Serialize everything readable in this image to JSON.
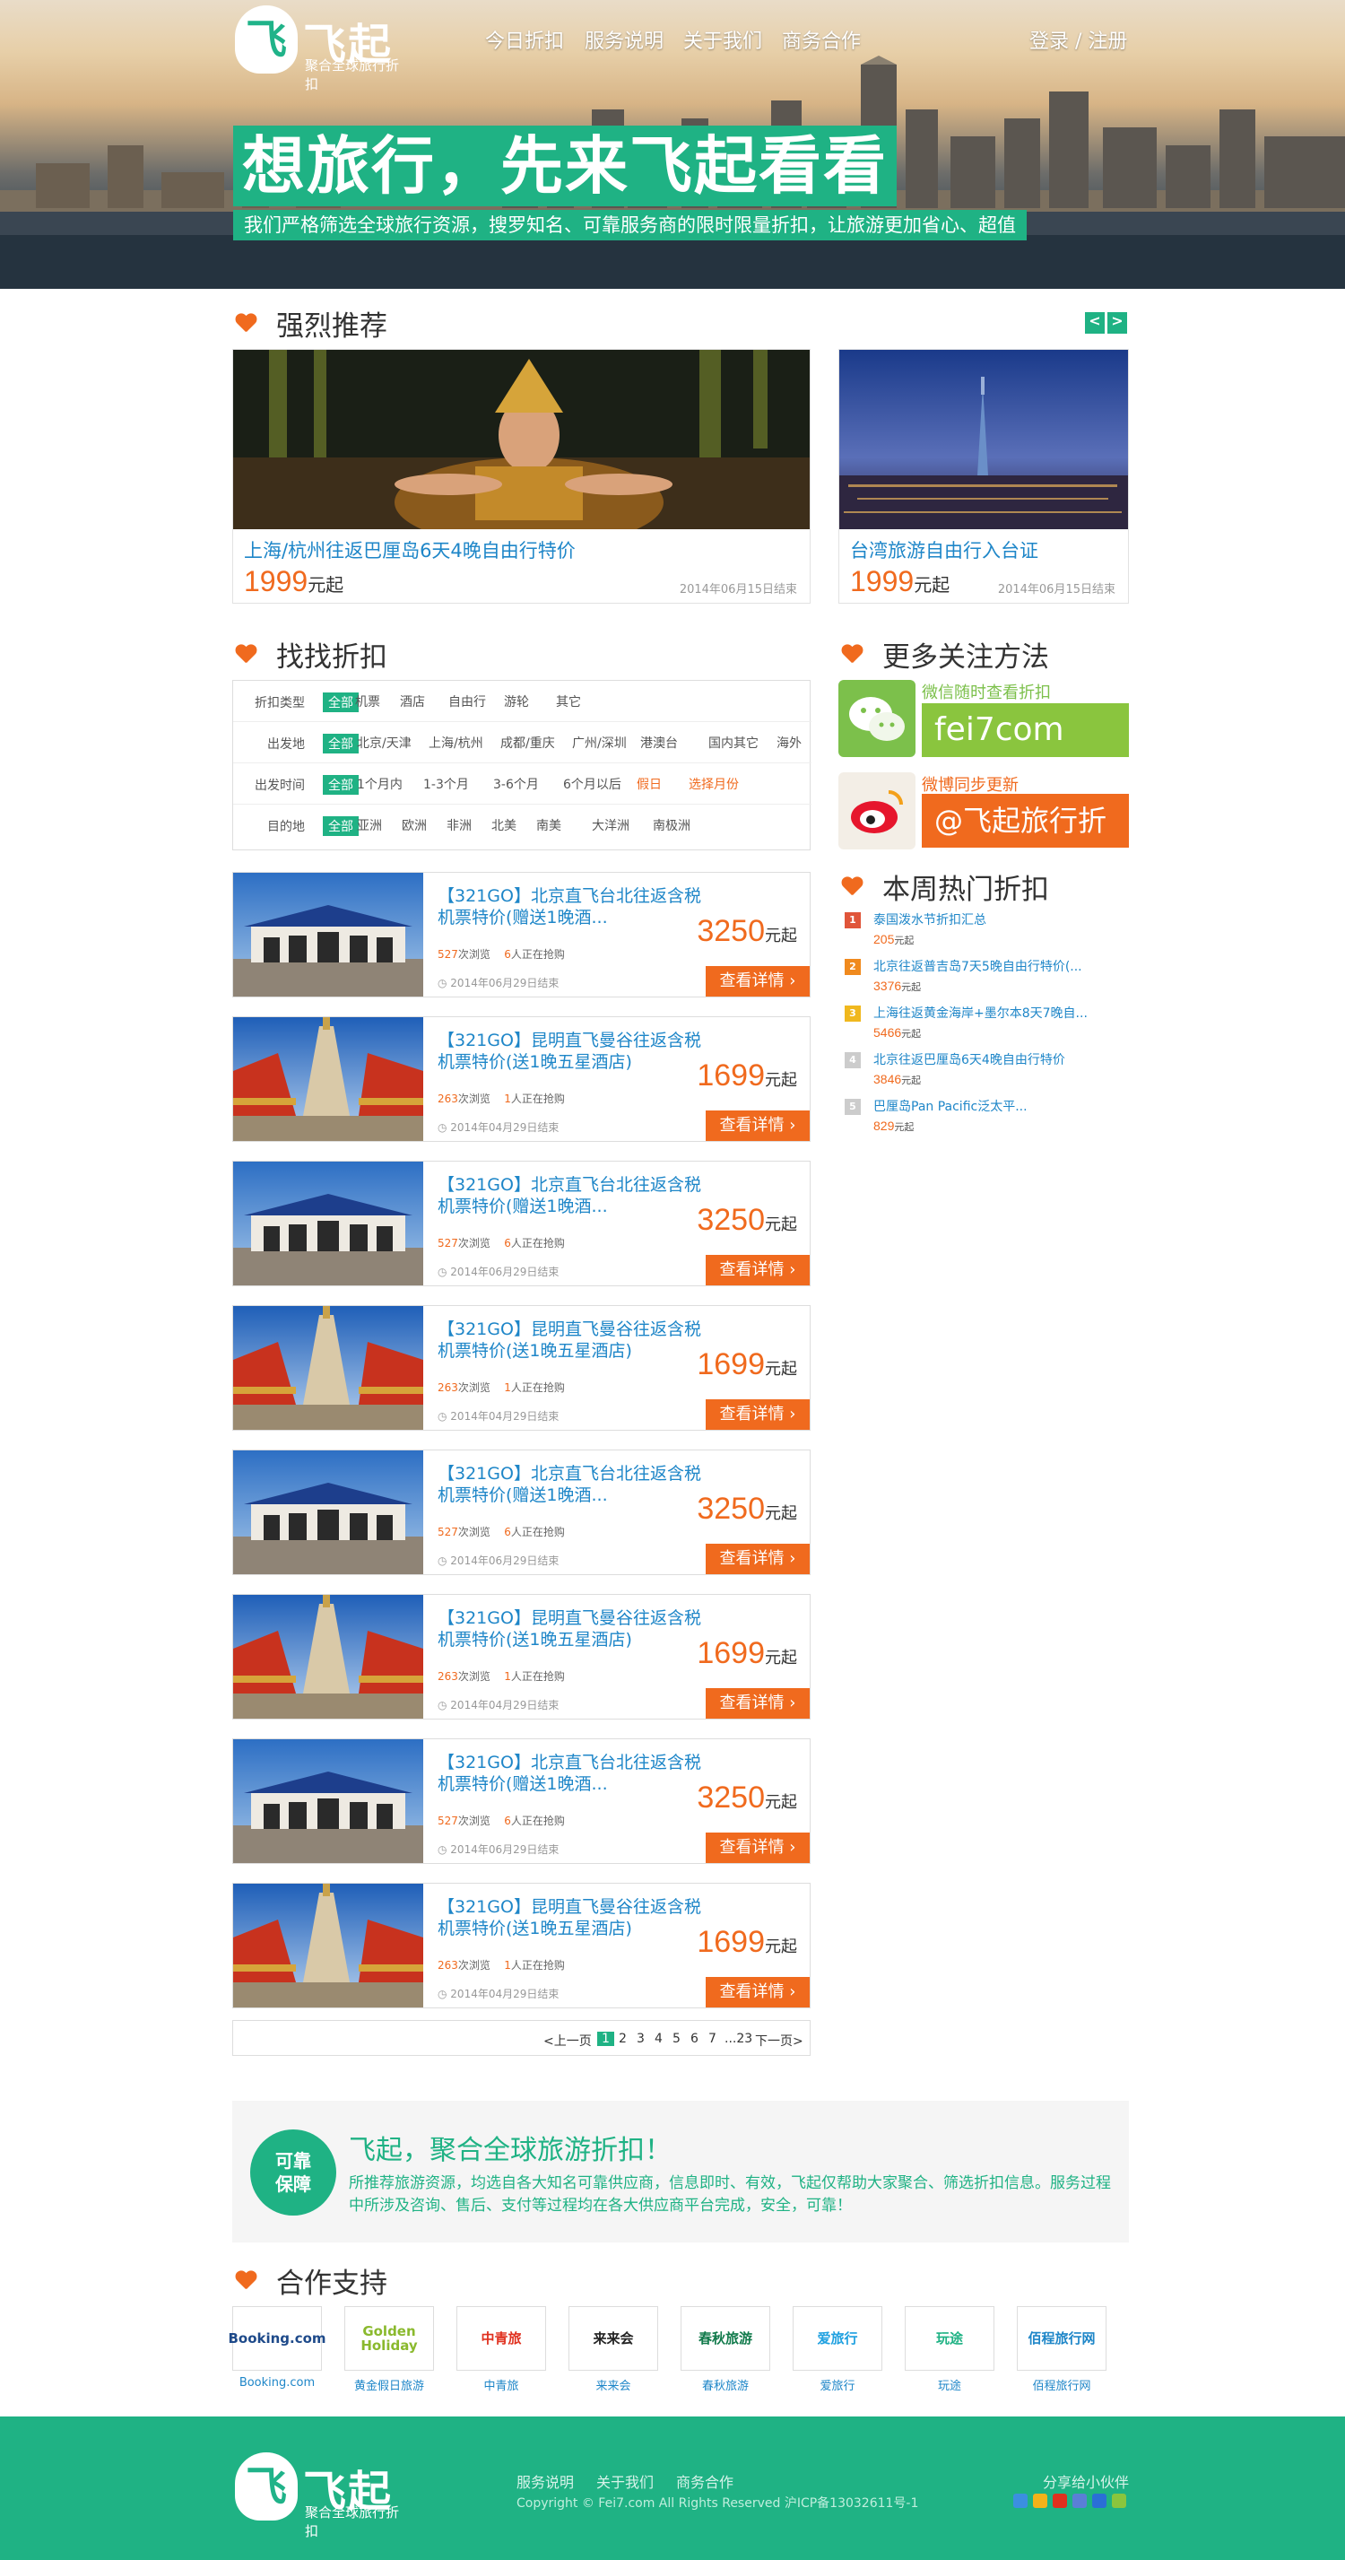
{
  "brand": {
    "name": "飞起",
    "tagline": "聚合全球旅行折扣",
    "glyph": "飞"
  },
  "nav": {
    "items": [
      "今日折扣",
      "服务说明",
      "关于我们",
      "商务合作"
    ],
    "login": "登录 / 注册"
  },
  "banner": {
    "title": "想旅行，先来飞起看看",
    "subtitle": "我们严格筛选全球旅行资源，搜罗知名、可靠服务商的限时限量折扣，让旅游更加省心、超值"
  },
  "recommend": {
    "heading": "强烈推荐",
    "prev": "<",
    "next": ">",
    "cards": [
      {
        "title": "上海/杭州往返巴厘岛6天4晚自由行特价",
        "price": "1999",
        "unit": "元起",
        "date": "2014年06月15日结束"
      },
      {
        "title": "台湾旅游自由行入台证",
        "price": "1999",
        "unit": "元起",
        "date": "2014年06月15日结束"
      }
    ]
  },
  "finder": {
    "heading": "找找折扣",
    "rows": [
      {
        "label": "折扣类型",
        "options": [
          "全部",
          "机票",
          "酒店",
          "自由行",
          "游轮",
          "其它"
        ]
      },
      {
        "label": "出发地",
        "options": [
          "全部",
          "北京/天津",
          "上海/杭州",
          "成都/重庆",
          "广州/深圳",
          "港澳台",
          "国内其它",
          "海外"
        ]
      },
      {
        "label": "出发时间",
        "options": [
          "全部",
          "1个月内",
          "1-3个月",
          "3-6个月",
          "6个月以后",
          "假日",
          "选择月份"
        ]
      },
      {
        "label": "目的地",
        "options": [
          "全部",
          "亚洲",
          "欧洲",
          "非洲",
          "北美",
          "南美",
          "大洋洲",
          "南极洲"
        ]
      }
    ]
  },
  "deals": [
    {
      "title": "【321GO】北京直飞台北往返含税机票特价(赠送1晚酒...",
      "views": "527",
      "views_label": "次浏览",
      "buyers": "6",
      "buyers_label": "人正在抢购",
      "date": "2014年06月29日结束",
      "price": "3250",
      "unit": "元起",
      "button": "查看详情 ›",
      "img": "taipei"
    },
    {
      "title": "【321GO】昆明直飞曼谷往返含税机票特价(送1晚五星酒店)",
      "views": "263",
      "views_label": "次浏览",
      "buyers": "1",
      "buyers_label": "人正在抢购",
      "date": "2014年04月29日结束",
      "price": "1699",
      "unit": "元起",
      "button": "查看详情 ›",
      "img": "bangkok"
    },
    {
      "title": "【321GO】北京直飞台北往返含税机票特价(赠送1晚酒...",
      "views": "527",
      "views_label": "次浏览",
      "buyers": "6",
      "buyers_label": "人正在抢购",
      "date": "2014年06月29日结束",
      "price": "3250",
      "unit": "元起",
      "button": "查看详情 ›",
      "img": "taipei"
    },
    {
      "title": "【321GO】昆明直飞曼谷往返含税机票特价(送1晚五星酒店)",
      "views": "263",
      "views_label": "次浏览",
      "buyers": "1",
      "buyers_label": "人正在抢购",
      "date": "2014年04月29日结束",
      "price": "1699",
      "unit": "元起",
      "button": "查看详情 ›",
      "img": "bangkok"
    },
    {
      "title": "【321GO】北京直飞台北往返含税机票特价(赠送1晚酒...",
      "views": "527",
      "views_label": "次浏览",
      "buyers": "6",
      "buyers_label": "人正在抢购",
      "date": "2014年06月29日结束",
      "price": "3250",
      "unit": "元起",
      "button": "查看详情 ›",
      "img": "taipei"
    },
    {
      "title": "【321GO】昆明直飞曼谷往返含税机票特价(送1晚五星酒店)",
      "views": "263",
      "views_label": "次浏览",
      "buyers": "1",
      "buyers_label": "人正在抢购",
      "date": "2014年04月29日结束",
      "price": "1699",
      "unit": "元起",
      "button": "查看详情 ›",
      "img": "bangkok"
    },
    {
      "title": "【321GO】北京直飞台北往返含税机票特价(赠送1晚酒...",
      "views": "527",
      "views_label": "次浏览",
      "buyers": "6",
      "buyers_label": "人正在抢购",
      "date": "2014年06月29日结束",
      "price": "3250",
      "unit": "元起",
      "button": "查看详情 ›",
      "img": "taipei"
    },
    {
      "title": "【321GO】昆明直飞曼谷往返含税机票特价(送1晚五星酒店)",
      "views": "263",
      "views_label": "次浏览",
      "buyers": "1",
      "buyers_label": "人正在抢购",
      "date": "2014年04月29日结束",
      "price": "1699",
      "unit": "元起",
      "button": "查看详情 ›",
      "img": "bangkok"
    }
  ],
  "pager": {
    "prev": "<上一页",
    "pages": [
      "1",
      "2",
      "3",
      "4",
      "5",
      "6",
      "7",
      "...23"
    ],
    "current": "1",
    "next": "下一页>"
  },
  "follow": {
    "heading": "更多关注方法",
    "wechat_label": "微信随时查看折扣",
    "wechat_id": "fei7com",
    "weibo_label": "微博同步更新",
    "weibo_id": "@飞起旅行折扣"
  },
  "hot": {
    "heading": "本周热门折扣",
    "items": [
      {
        "rank": "1",
        "title": "泰国泼水节折扣汇总",
        "value": "205",
        "unit": "元起"
      },
      {
        "rank": "2",
        "title": "北京往返普吉岛7天5晚自由行特价(...",
        "value": "3376",
        "unit": "元起"
      },
      {
        "rank": "3",
        "title": "上海往返黄金海岸+墨尔本8天7晚自...",
        "value": "5466",
        "unit": "元起"
      },
      {
        "rank": "4",
        "title": "北京往返巴厘岛6天4晚自由行特价",
        "value": "3846",
        "unit": "元起"
      },
      {
        "rank": "5",
        "title": "巴厘岛Pan Pacific泛太平...",
        "value": "829",
        "unit": "元起"
      }
    ]
  },
  "assurance": {
    "badge_line1": "可靠",
    "badge_line2": "保障",
    "heading": "飞起，聚合全球旅游折扣！",
    "text": "所推荐旅游资源，均选自各大知名可靠供应商，信息即时、有效，飞起仅帮助大家聚合、筛选折扣信息。服务过程中所涉及咨询、售后、支付等过程均在各大供应商平台完成，安全，可靠！"
  },
  "partners": {
    "heading": "合作支持",
    "items": [
      {
        "logo": "Booking.com",
        "name": "Booking.com",
        "color": "#1e4a8a"
      },
      {
        "logo": "Golden Holiday",
        "name": "黄金假日旅游",
        "color": "#8ab92d"
      },
      {
        "logo": "中青旅",
        "name": "中青旅",
        "color": "#e0301e"
      },
      {
        "logo": "来来会",
        "name": "来来会",
        "color": "#222222"
      },
      {
        "logo": "春秋旅游",
        "name": "春秋旅游",
        "color": "#117a4b"
      },
      {
        "logo": "爱旅行",
        "name": "爱旅行",
        "color": "#1ea0e0"
      },
      {
        "logo": "玩途",
        "name": "玩途",
        "color": "#1fb284"
      },
      {
        "logo": "佰程旅行网",
        "name": "佰程旅行网",
        "color": "#1e86c8"
      }
    ]
  },
  "footer": {
    "links": [
      "服务说明",
      "关于我们",
      "商务合作"
    ],
    "copyright": "Copyright © Fei7.com All Rights Reserved 沪ICP备13032611号-1",
    "share_label": "分享给小伙伴",
    "share_colors": [
      "#3b8fe0",
      "#f3b21a",
      "#e0301e",
      "#5a7fd6",
      "#2a6fd6",
      "#8ac53e"
    ]
  },
  "colors": {
    "accent": "#1fb284",
    "orange": "#f06a1e",
    "link": "#1e86c8"
  }
}
